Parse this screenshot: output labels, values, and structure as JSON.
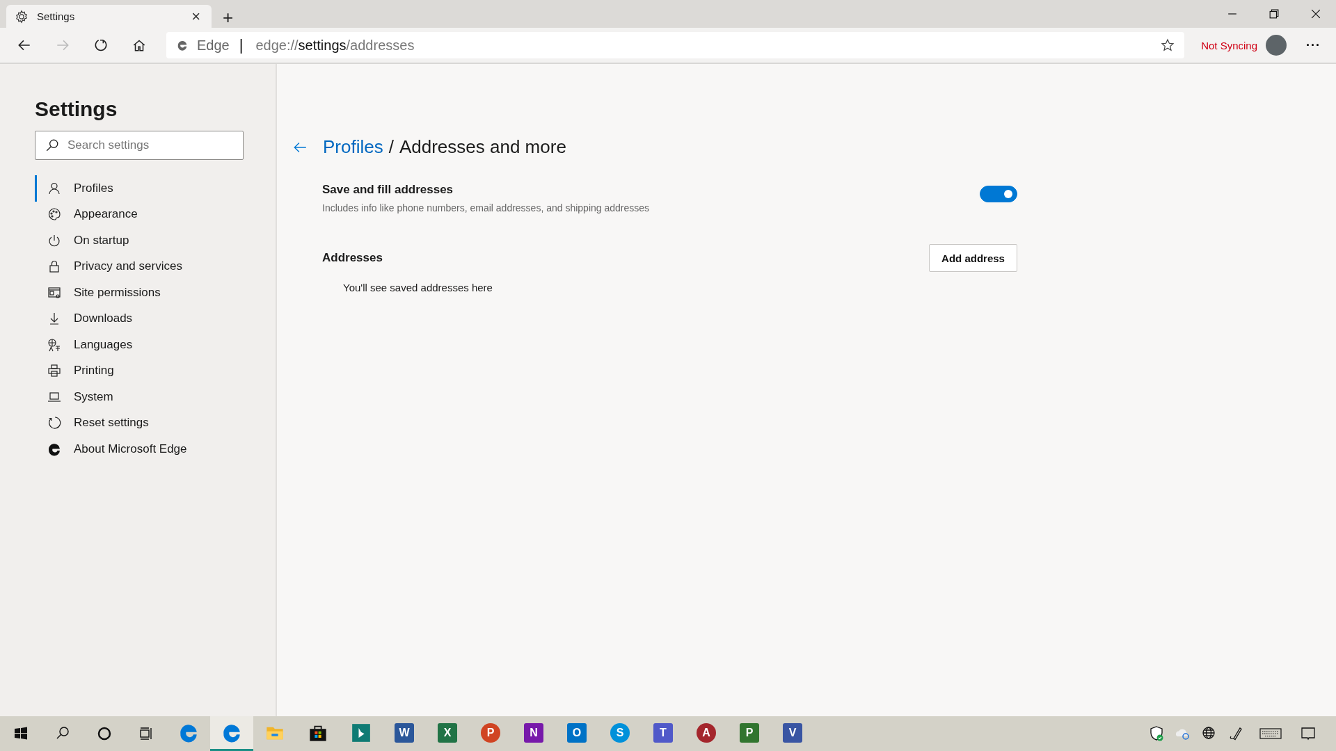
{
  "tab": {
    "title": "Settings",
    "close": "×",
    "new_tab": "+"
  },
  "address_bar": {
    "site_label": "Edge",
    "separator": "|",
    "url_scheme": "edge://",
    "url_host": "settings",
    "url_path": "/addresses"
  },
  "profile": {
    "sync_status": "Not Syncing",
    "more": "···"
  },
  "sidebar": {
    "title": "Settings",
    "search": {
      "placeholder": "Search settings"
    },
    "items": [
      {
        "label": "Profiles",
        "selected": true
      },
      {
        "label": "Appearance",
        "selected": false
      },
      {
        "label": "On startup",
        "selected": false
      },
      {
        "label": "Privacy and services",
        "selected": false
      },
      {
        "label": "Site permissions",
        "selected": false
      },
      {
        "label": "Downloads",
        "selected": false
      },
      {
        "label": "Languages",
        "selected": false
      },
      {
        "label": "Printing",
        "selected": false
      },
      {
        "label": "System",
        "selected": false
      },
      {
        "label": "Reset settings",
        "selected": false
      },
      {
        "label": "About Microsoft Edge",
        "selected": false
      }
    ]
  },
  "page": {
    "breadcrumb_link": "Profiles",
    "breadcrumb_separator": "/",
    "title": "Addresses and more",
    "setting": {
      "label": "Save and fill addresses",
      "description": "Includes info like phone numbers, email addresses, and shipping addresses",
      "on": true
    },
    "addresses": {
      "heading": "Addresses",
      "button": "Add address",
      "empty_message": "You'll see saved addresses here"
    }
  },
  "taskbar": {
    "apps": [
      {
        "kind": "edge",
        "selected": false
      },
      {
        "kind": "edge",
        "selected": true
      },
      {
        "kind": "folder",
        "selected": false
      },
      {
        "kind": "store",
        "selected": false
      },
      {
        "kind": "tile",
        "color": "#0f7b74",
        "selected": false
      },
      {
        "kind": "tile",
        "letter": "W",
        "color": "#2b579a",
        "selected": false
      },
      {
        "kind": "tile",
        "letter": "X",
        "color": "#217346",
        "selected": false
      },
      {
        "kind": "round",
        "letter": "P",
        "color": "#d04423",
        "selected": false
      },
      {
        "kind": "tile",
        "letter": "N",
        "color": "#7719aa",
        "selected": false
      },
      {
        "kind": "tile",
        "letter": "O",
        "color": "#0072c6",
        "selected": false
      },
      {
        "kind": "round",
        "letter": "S",
        "color": "#0091da",
        "selected": false
      },
      {
        "kind": "tile",
        "letter": "T",
        "color": "#5059c9",
        "selected": false
      },
      {
        "kind": "round",
        "letter": "A",
        "color": "#a4262c",
        "selected": false
      },
      {
        "kind": "tile",
        "letter": "P",
        "color": "#31752f",
        "selected": false
      },
      {
        "kind": "tile",
        "letter": "V",
        "color": "#3955a3",
        "selected": false
      }
    ]
  }
}
